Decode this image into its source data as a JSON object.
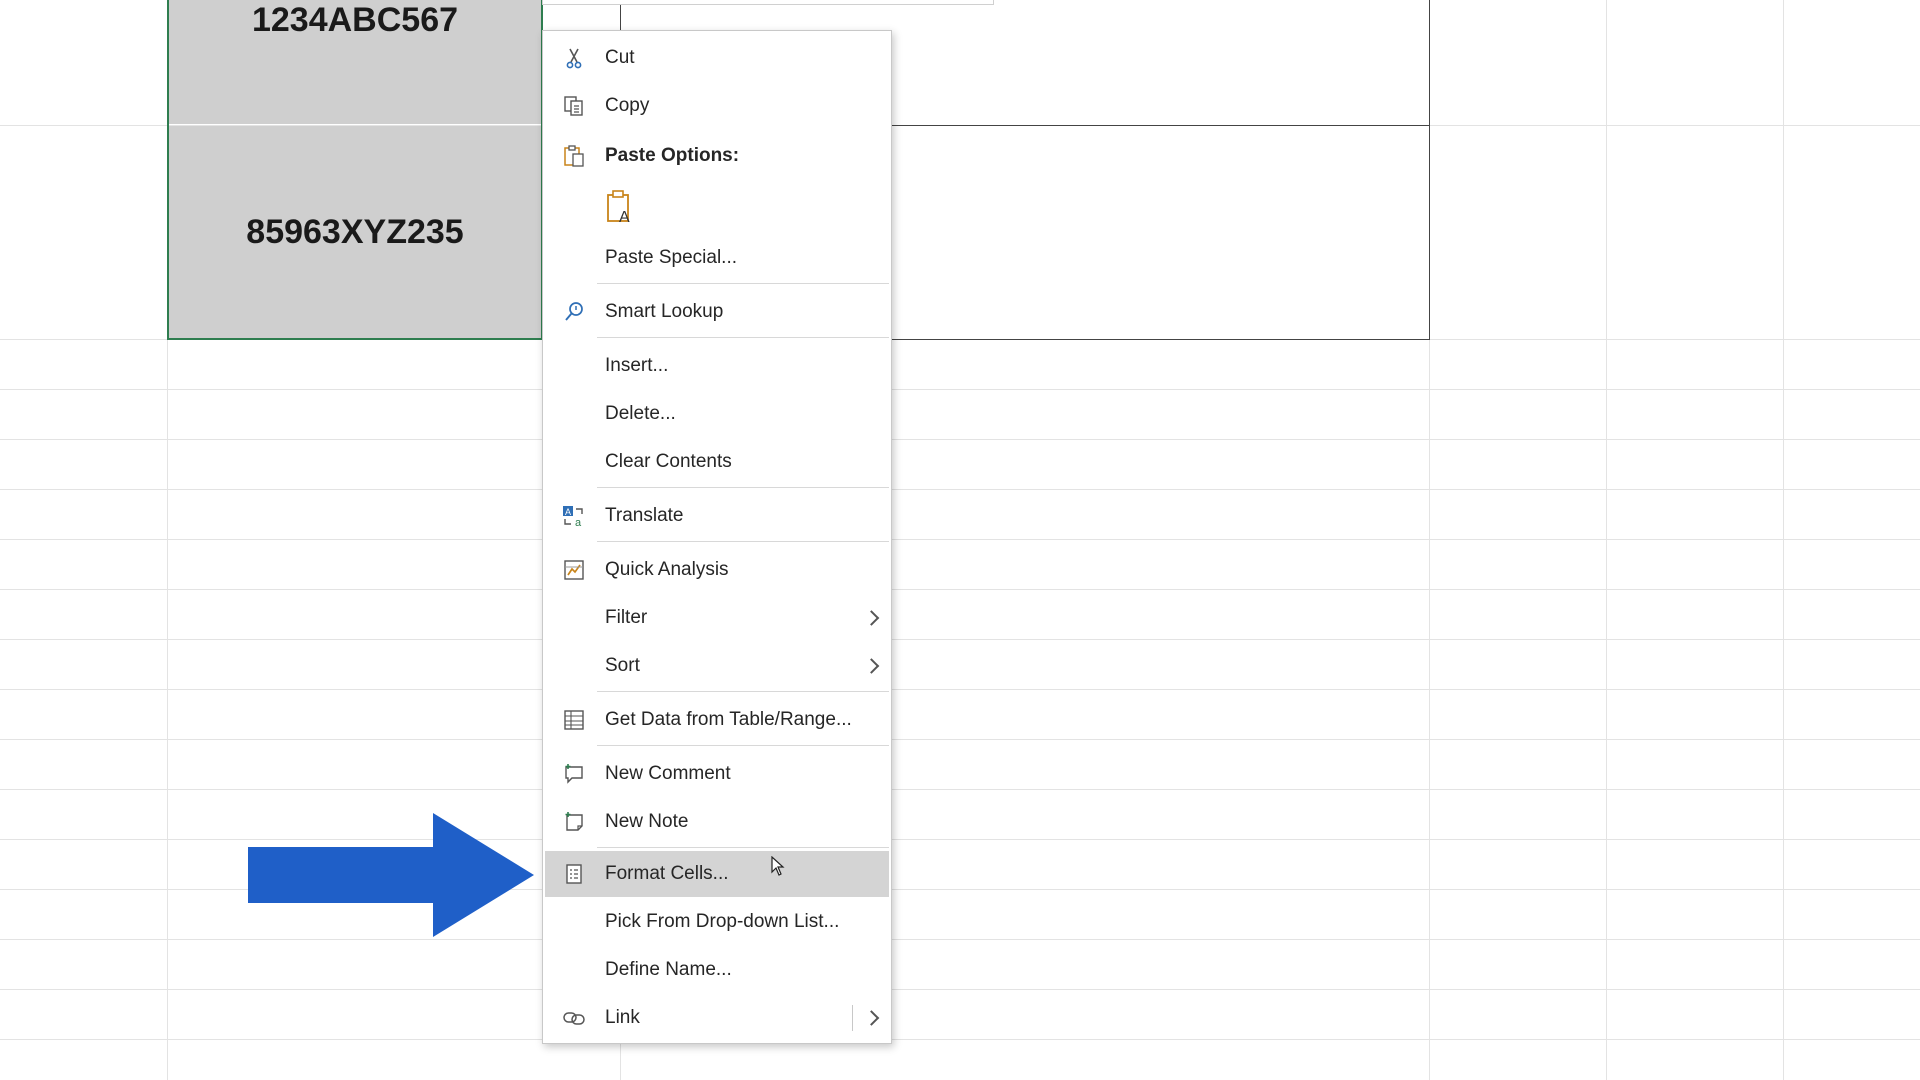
{
  "sheet": {
    "cells": [
      "1234ABC567",
      "85963XYZ235"
    ]
  },
  "context_menu": {
    "items": [
      {
        "label": "Cut",
        "icon": "scissors-icon"
      },
      {
        "label": "Copy",
        "icon": "copy-icon"
      },
      {
        "label": "Paste Options:",
        "icon": "paste-icon"
      },
      {
        "label": "",
        "icon": "paste-text-only-icon"
      },
      {
        "label": "Paste Special...",
        "icon": ""
      },
      {
        "label": "Smart Lookup",
        "icon": "search-icon"
      },
      {
        "label": "Insert...",
        "icon": ""
      },
      {
        "label": "Delete...",
        "icon": ""
      },
      {
        "label": "Clear Contents",
        "icon": ""
      },
      {
        "label": "Translate",
        "icon": "translate-icon"
      },
      {
        "label": "Quick Analysis",
        "icon": "quick-analysis-icon"
      },
      {
        "label": "Filter",
        "icon": "",
        "submenu": true
      },
      {
        "label": "Sort",
        "icon": "",
        "submenu": true
      },
      {
        "label": "Get Data from Table/Range...",
        "icon": "table-icon"
      },
      {
        "label": "New Comment",
        "icon": "comment-icon"
      },
      {
        "label": "New Note",
        "icon": "note-icon"
      },
      {
        "label": "Format Cells...",
        "icon": "format-cells-icon",
        "highlighted": true
      },
      {
        "label": "Pick From Drop-down List...",
        "icon": ""
      },
      {
        "label": "Define Name...",
        "icon": ""
      },
      {
        "label": "Link",
        "icon": "link-icon",
        "submenu": true
      }
    ]
  },
  "colors": {
    "selection_fill": "#cfcfcf",
    "selection_border": "#2e7d4f",
    "menu_hover": "#d4d4d4",
    "annotation_arrow": "#1f5fc8",
    "icon_accent": "#c8841a",
    "icon_blue": "#2f6fb6"
  }
}
